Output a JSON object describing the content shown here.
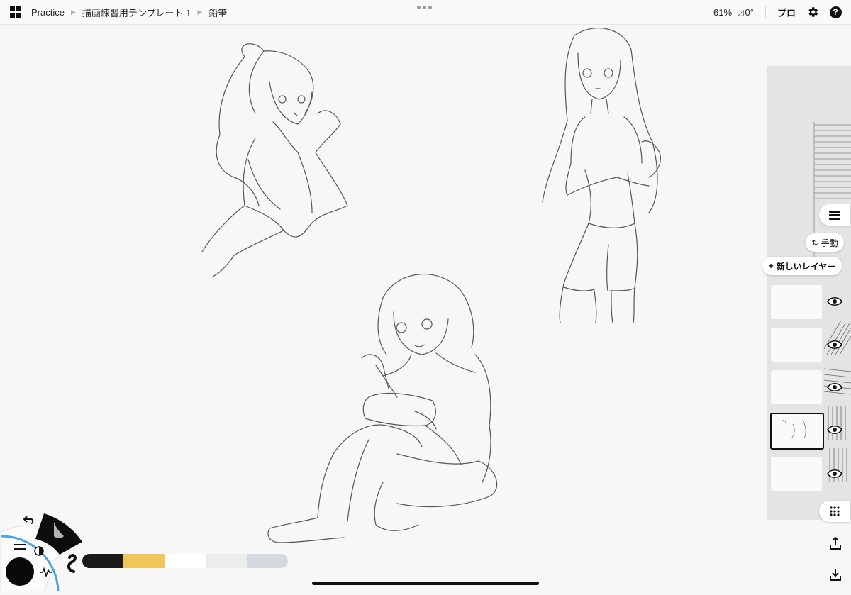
{
  "topbar": {
    "breadcrumb": [
      "Practice",
      "描画練習用テンプレート 1",
      "鉛筆"
    ],
    "zoom": "61%",
    "rotation": "0°",
    "pro_label": "プロ"
  },
  "layers": {
    "sort_label": "手動",
    "new_layer_label": "新しいレイヤー"
  },
  "colors": {
    "palette": [
      "#1a1a1a",
      "#f0c65a",
      "#ffffff",
      "#ececec",
      "#d5d8dc"
    ],
    "accent": "#4da3e0"
  },
  "icons": [
    "grid-icon",
    "more-dots-icon",
    "rotate-icon",
    "gear-icon",
    "help-icon",
    "layers-stack-icon",
    "sort-icon",
    "eye-icon",
    "grid-dots-icon",
    "export-icon",
    "import-icon",
    "undo-icon",
    "menu-icon",
    "contrast-icon",
    "brush-icon",
    "squiggle-icon",
    "wave-icon"
  ]
}
